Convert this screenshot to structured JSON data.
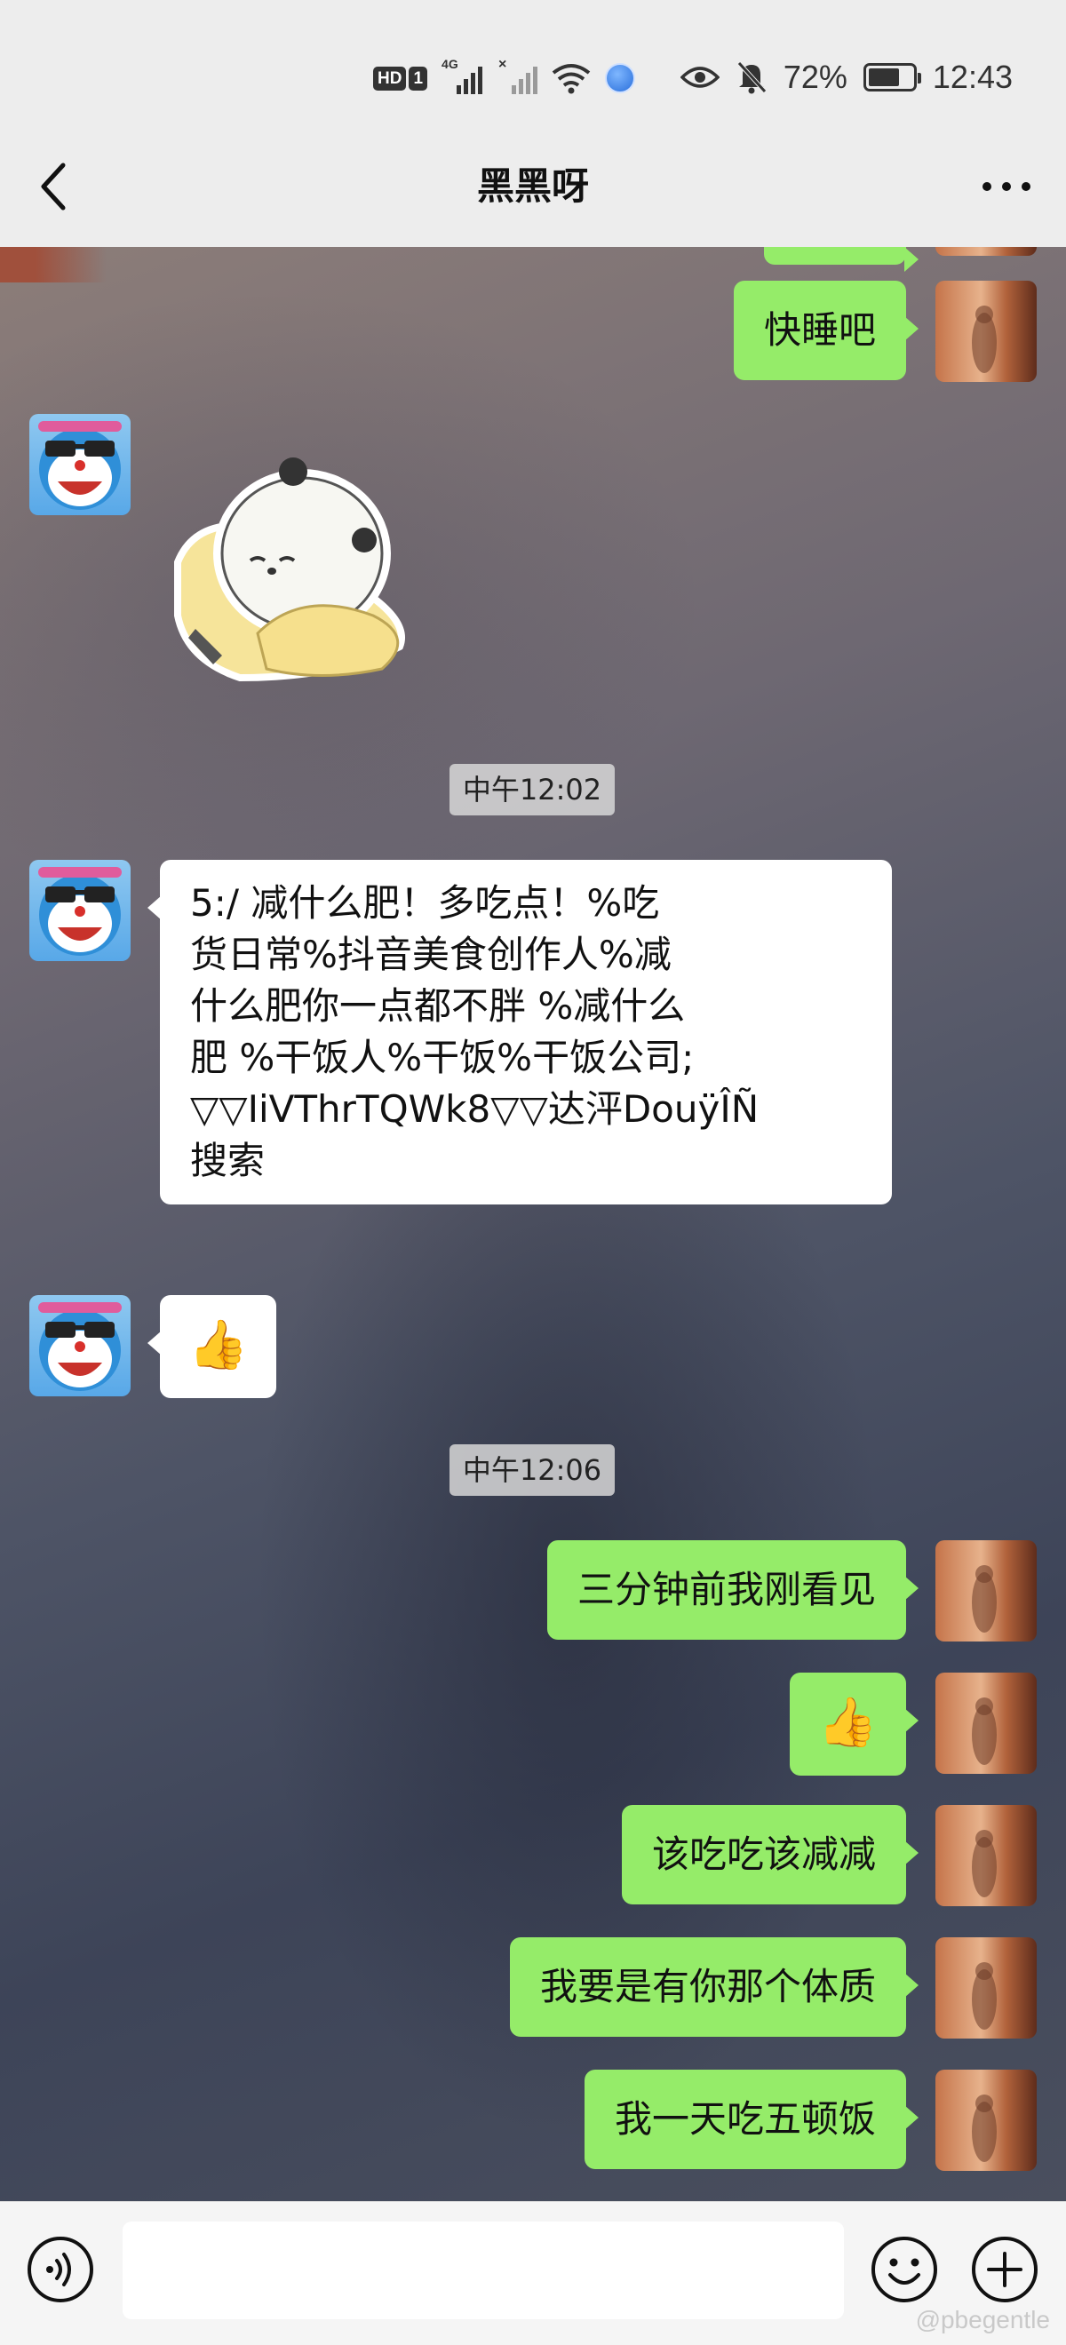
{
  "status_bar": {
    "hd_label": "HD",
    "sim_label": "1",
    "network_label": "4G",
    "battery": "72%",
    "battery_level": 0.72,
    "time": "12:43",
    "icons": [
      "hd-icon",
      "signal-icon",
      "signal-off-icon",
      "wifi-icon",
      "browser-icon",
      "eye-icon",
      "mute-icon",
      "battery-icon"
    ]
  },
  "nav": {
    "title": "黑黑呀"
  },
  "messages": [
    {
      "side": "right",
      "type": "text",
      "text": "快睡吧"
    },
    {
      "side": "left",
      "type": "sticker",
      "icon": "sleeping-panda-sticker"
    },
    {
      "type": "timestamp",
      "text": "中午12:02"
    },
    {
      "side": "left",
      "type": "text",
      "lines": [
        "5:/ 减什么肥！多吃点！%吃",
        "货日常%抖音美食创作人%减",
        "什么肥你一点都不胖 %减什么",
        "肥 %干饭人%干饭%干饭公司;",
        "▽▽IiVThrTQWk8▽▽达泙DouÿÎÑ",
        "搜索"
      ]
    },
    {
      "side": "left",
      "type": "emoji",
      "text": "👍"
    },
    {
      "type": "timestamp",
      "text": "中午12:06"
    },
    {
      "side": "right",
      "type": "text",
      "text": "三分钟前我刚看见"
    },
    {
      "side": "right",
      "type": "emoji",
      "text": "👍"
    },
    {
      "side": "right",
      "type": "text",
      "text": "该吃吃该减减"
    },
    {
      "side": "right",
      "type": "text",
      "text": "我要是有你那个体质"
    },
    {
      "side": "right",
      "type": "text",
      "text": "我一天吃五顿饭"
    }
  ],
  "input_bar": {
    "voice_icon": "voice-icon",
    "emoji_icon": "emoji-icon",
    "plus_icon": "plus-icon"
  },
  "watermark": "@pbegentle",
  "colors": {
    "green_bubble": "#95ec69",
    "white_bubble": "#ffffff",
    "bar_background": "#ededed"
  }
}
